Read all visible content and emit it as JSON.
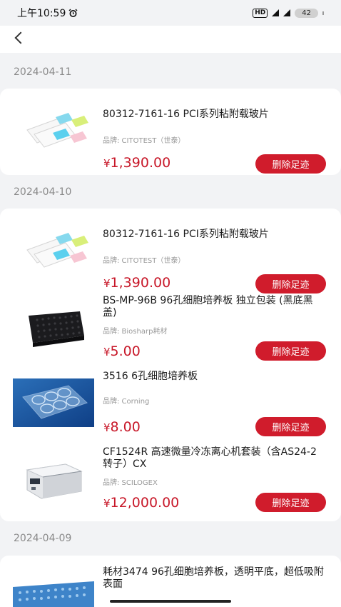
{
  "status_bar": {
    "time": "上午10:59",
    "alarm_icon": "alarm-clock-icon",
    "hd": "HD",
    "battery": "42"
  },
  "nav": {
    "back_icon": "chevron-left-icon"
  },
  "groups": [
    {
      "date": "2024-04-11",
      "items": [
        {
          "image": "slides-icon",
          "title": "80312-7161-16 PCI系列粘附载玻片",
          "brand": "品牌: CITOTEST（世泰）",
          "currency": "¥",
          "price": "1,390.00",
          "action": "删除足迹"
        }
      ]
    },
    {
      "date": "2024-04-10",
      "items": [
        {
          "image": "slides-icon",
          "title": "80312-7161-16 PCI系列粘附载玻片",
          "brand": "品牌: CITOTEST（世泰）",
          "currency": "¥",
          "price": "1,390.00",
          "action": "删除足迹"
        },
        {
          "image": "96-well-plate-icon",
          "title": "BS-MP-96B 96孔细胞培养板 独立包装 (黑底黑盖)",
          "brand": "品牌: Biosharp耗材",
          "currency": "¥",
          "price": "5.00",
          "action": "删除足迹"
        },
        {
          "image": "6-well-plate-icon",
          "title": "3516 6孔细胞培养板",
          "brand": "品牌: Corning",
          "currency": "¥",
          "price": "8.00",
          "action": "删除足迹"
        },
        {
          "image": "centrifuge-icon",
          "title": "CF1524R 高速微量冷冻离心机套装（含AS24-2转子）CX",
          "brand": "品牌: SCILOGEX",
          "currency": "¥",
          "price": "12,000.00",
          "action": "删除足迹"
        }
      ]
    },
    {
      "date": "2024-04-09",
      "items": [
        {
          "image": "clear-96-well-plate-icon",
          "title": "耗材3474 96孔细胞培养板，透明平底，超低吸附表面"
        }
      ]
    }
  ],
  "colors": {
    "accent": "#d01c2c",
    "price": "#c8192a",
    "background": "#f2f3f5"
  }
}
